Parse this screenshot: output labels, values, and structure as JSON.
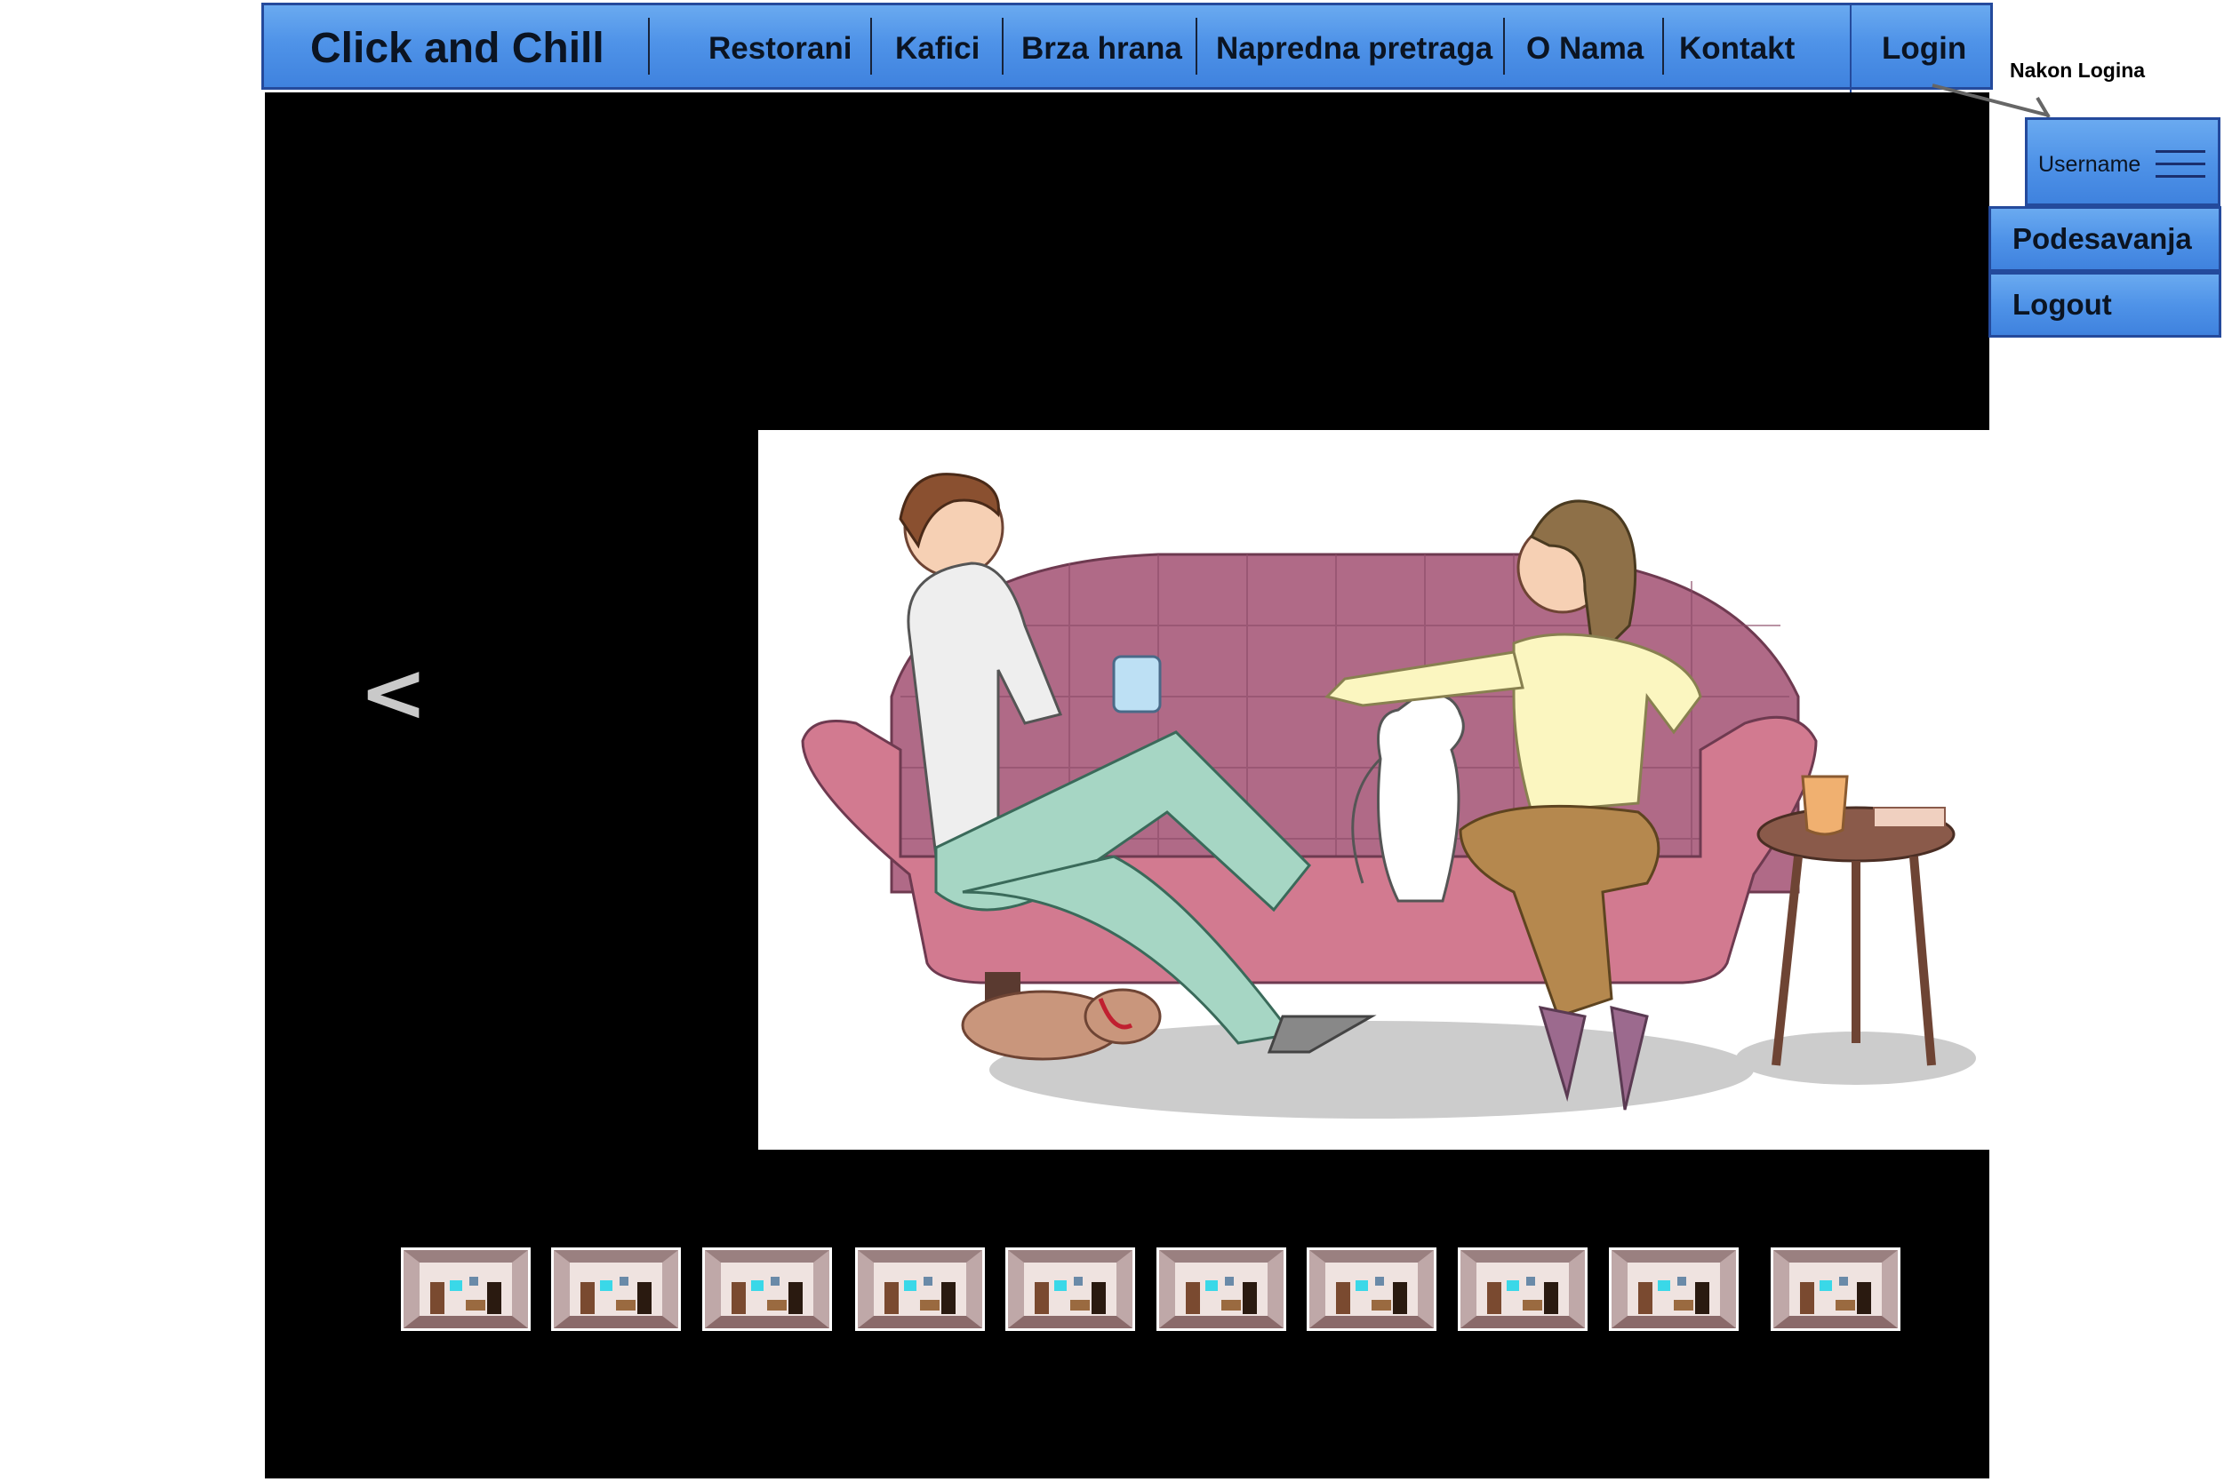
{
  "nav": {
    "brand": "Click and Chill",
    "links": [
      "Restorani",
      "Kafici",
      "Brza hrana",
      "Napredna pretraga",
      "O Nama",
      "Kontakt"
    ],
    "login": "Login"
  },
  "annotation": "Nakon Logina",
  "user_menu": {
    "username": "Username",
    "items": [
      "Podesavanja",
      "Logout"
    ]
  },
  "gallery": {
    "prev": "<",
    "next": ">",
    "thumbnail_count": 10
  },
  "colors": {
    "nav_blue": "#4f93e8",
    "nav_border": "#244a9c",
    "stage_bg": "#000000"
  }
}
